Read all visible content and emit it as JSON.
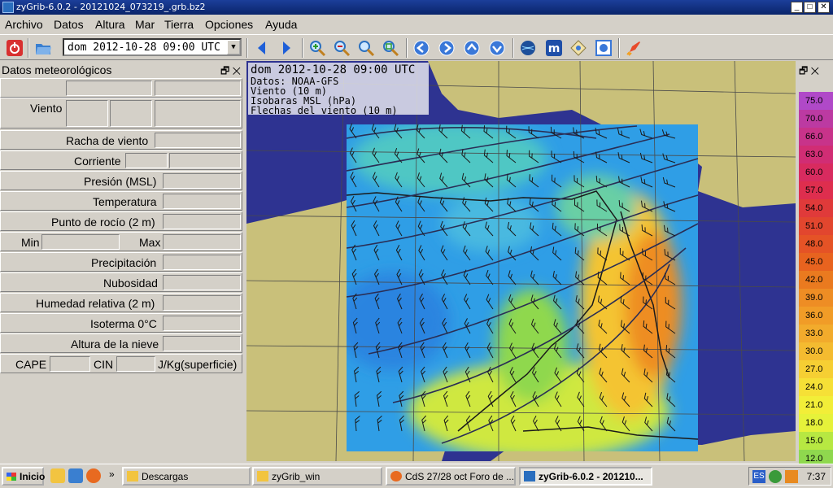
{
  "window": {
    "title": "zyGrib-6.0.2 - 20121024_073219_.grb.bz2"
  },
  "menu": [
    "Archivo",
    "Datos",
    "Altura",
    "Mar",
    "Tierra",
    "Opciones",
    "Ayuda"
  ],
  "toolbar": {
    "date_value": "dom 2012-10-28 09:00 UTC"
  },
  "left_panel": {
    "title": "Datos meteorológicos",
    "rows": {
      "viento": "Viento",
      "racha": "Racha de viento",
      "corriente": "Corriente",
      "presion": "Presión (MSL)",
      "temperatura": "Temperatura",
      "rocio": "Punto de rocío (2 m)",
      "min": "Min",
      "max": "Max",
      "precipitacion": "Precipitación",
      "nubosidad": "Nubosidad",
      "humedad": "Humedad relativa (2 m)",
      "isoterma": "Isoterma 0°C",
      "nieve": "Altura de la nieve",
      "cape": "CAPE",
      "cin": "CIN",
      "cape_unit": "J/Kg(superficie)"
    }
  },
  "map": {
    "info": {
      "date": "dom 2012-10-28 09:00 UTC",
      "source": "Datos: NOAA-GFS",
      "layer1": "Viento (10 m)",
      "layer2": "Isobaras MSL (hPa)",
      "layer3": "Flechas del viento (10 m)"
    }
  },
  "colorbar": {
    "items": [
      {
        "label": "75.0",
        "color": "#b049c8"
      },
      {
        "label": "70.0",
        "color": "#bc3aa2"
      },
      {
        "label": "66.0",
        "color": "#c8338a"
      },
      {
        "label": "63.0",
        "color": "#d12d74"
      },
      {
        "label": "60.0",
        "color": "#d82b5f"
      },
      {
        "label": "57.0",
        "color": "#de2e4e"
      },
      {
        "label": "54.0",
        "color": "#e03a3a"
      },
      {
        "label": "51.0",
        "color": "#e2462e"
      },
      {
        "label": "48.0",
        "color": "#e55326"
      },
      {
        "label": "45.0",
        "color": "#e8631f"
      },
      {
        "label": "42.0",
        "color": "#ea7a1f"
      },
      {
        "label": "39.0",
        "color": "#ee8d24"
      },
      {
        "label": "36.0",
        "color": "#f19c27"
      },
      {
        "label": "33.0",
        "color": "#f2ab2c"
      },
      {
        "label": "30.0",
        "color": "#f4bb30"
      },
      {
        "label": "27.0",
        "color": "#f6cf33"
      },
      {
        "label": "24.0",
        "color": "#f6e036"
      },
      {
        "label": "21.0",
        "color": "#f2ee38"
      },
      {
        "label": "18.0",
        "color": "#e6f23a"
      },
      {
        "label": "15.0",
        "color": "#b7e842"
      },
      {
        "label": "12.0",
        "color": "#8fd84e"
      }
    ]
  },
  "taskbar": {
    "start": "Inicio",
    "tasks": [
      "Descargas",
      "zyGrib_win",
      "CdS 27/28 oct Foro de ...",
      "zyGrib-6.0.2 - 201210..."
    ],
    "lang": "ES",
    "clock": "7:37"
  }
}
